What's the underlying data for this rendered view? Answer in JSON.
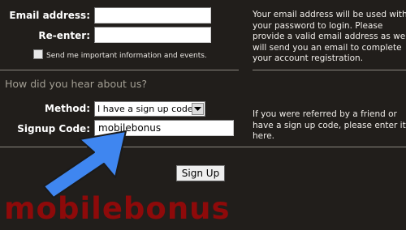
{
  "form": {
    "email_label": "Email address:",
    "email_value": "",
    "reenter_label": "Re-enter:",
    "reenter_value": "",
    "newsletter_label": "Send me important information and events.",
    "newsletter_checked": false,
    "email_info": "Your email address will be used with your password to login. Please provide a valid email address as we will send you an email to complete your account registration."
  },
  "referral": {
    "section_title": "How did you hear about us?",
    "method_label": "Method:",
    "method_selected": "I have a sign up code",
    "signup_code_label": "Signup Code:",
    "signup_code_value": "mobilebonus",
    "referral_info": "If you were referred by a friend or have a sign up code, please enter it here."
  },
  "actions": {
    "signup_button": "Sign Up"
  },
  "overlay": {
    "arrow_color": "#3f86f0",
    "watermark_text": "mobilebonus",
    "watermark_color": "#8e0a0a"
  }
}
